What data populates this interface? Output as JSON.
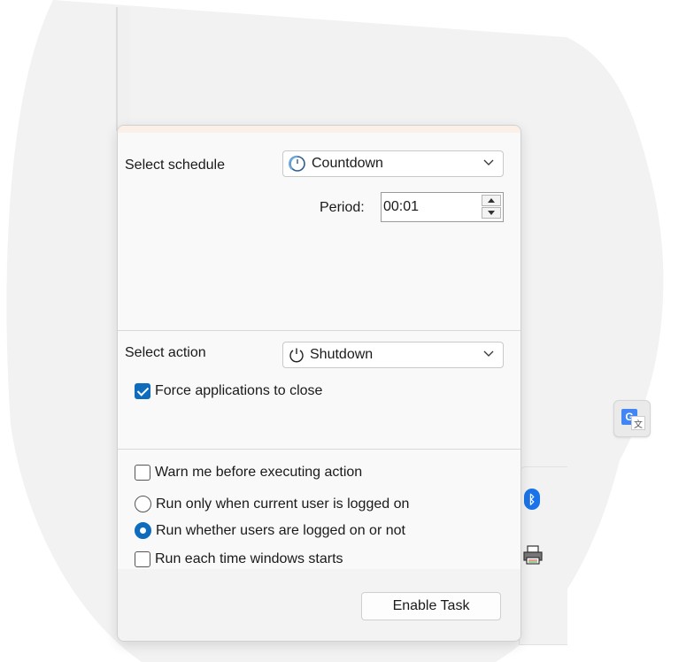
{
  "schedule": {
    "label": "Select  schedule",
    "selected": "Countdown",
    "icon": "countdown-timer-icon",
    "period_label": "Period:",
    "period_value": "00:01"
  },
  "action": {
    "label": "Select  action",
    "selected": "Shutdown",
    "icon": "power-icon",
    "force_close_label": "Force applications to close",
    "force_close_checked": true
  },
  "options": {
    "warn_label": "Warn me before executing action",
    "warn_checked": false,
    "run_when_logged_on_label": "Run only when current user is logged on",
    "run_whether_logged_on_label": "Run whether users are logged on or not",
    "selected_run_mode": "run_whether_logged_on",
    "run_each_start_label": "Run each time windows starts",
    "run_each_start_checked": false
  },
  "footer": {
    "enable_button_label": "Enable Task"
  },
  "background": {
    "bluetooth_icon": "bluetooth-icon",
    "printer_icon": "printer-icon",
    "translate_icon": "google-translate-icon",
    "accent_color": "#0f6cbd"
  }
}
